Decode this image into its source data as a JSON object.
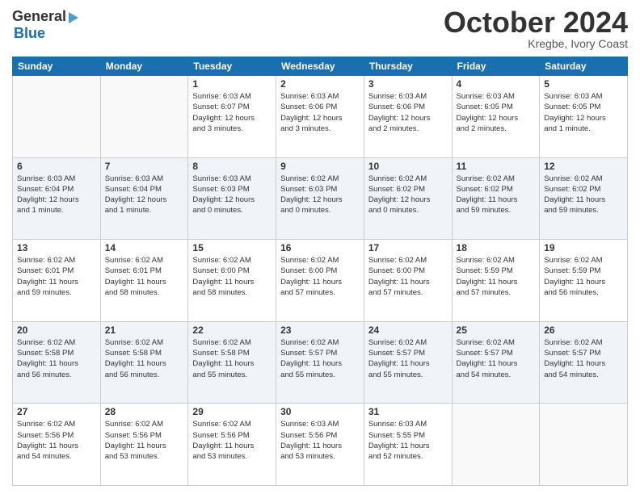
{
  "logo": {
    "top": "General",
    "arrow": "▶",
    "bottom": "Blue"
  },
  "title": "October 2024",
  "subtitle": "Kregbe, Ivory Coast",
  "days_of_week": [
    "Sunday",
    "Monday",
    "Tuesday",
    "Wednesday",
    "Thursday",
    "Friday",
    "Saturday"
  ],
  "weeks": [
    [
      {
        "num": "",
        "info": ""
      },
      {
        "num": "",
        "info": ""
      },
      {
        "num": "1",
        "info": "Sunrise: 6:03 AM\nSunset: 6:07 PM\nDaylight: 12 hours\nand 3 minutes."
      },
      {
        "num": "2",
        "info": "Sunrise: 6:03 AM\nSunset: 6:06 PM\nDaylight: 12 hours\nand 3 minutes."
      },
      {
        "num": "3",
        "info": "Sunrise: 6:03 AM\nSunset: 6:06 PM\nDaylight: 12 hours\nand 2 minutes."
      },
      {
        "num": "4",
        "info": "Sunrise: 6:03 AM\nSunset: 6:05 PM\nDaylight: 12 hours\nand 2 minutes."
      },
      {
        "num": "5",
        "info": "Sunrise: 6:03 AM\nSunset: 6:05 PM\nDaylight: 12 hours\nand 1 minute."
      }
    ],
    [
      {
        "num": "6",
        "info": "Sunrise: 6:03 AM\nSunset: 6:04 PM\nDaylight: 12 hours\nand 1 minute."
      },
      {
        "num": "7",
        "info": "Sunrise: 6:03 AM\nSunset: 6:04 PM\nDaylight: 12 hours\nand 1 minute."
      },
      {
        "num": "8",
        "info": "Sunrise: 6:03 AM\nSunset: 6:03 PM\nDaylight: 12 hours\nand 0 minutes."
      },
      {
        "num": "9",
        "info": "Sunrise: 6:02 AM\nSunset: 6:03 PM\nDaylight: 12 hours\nand 0 minutes."
      },
      {
        "num": "10",
        "info": "Sunrise: 6:02 AM\nSunset: 6:02 PM\nDaylight: 12 hours\nand 0 minutes."
      },
      {
        "num": "11",
        "info": "Sunrise: 6:02 AM\nSunset: 6:02 PM\nDaylight: 11 hours\nand 59 minutes."
      },
      {
        "num": "12",
        "info": "Sunrise: 6:02 AM\nSunset: 6:02 PM\nDaylight: 11 hours\nand 59 minutes."
      }
    ],
    [
      {
        "num": "13",
        "info": "Sunrise: 6:02 AM\nSunset: 6:01 PM\nDaylight: 11 hours\nand 59 minutes."
      },
      {
        "num": "14",
        "info": "Sunrise: 6:02 AM\nSunset: 6:01 PM\nDaylight: 11 hours\nand 58 minutes."
      },
      {
        "num": "15",
        "info": "Sunrise: 6:02 AM\nSunset: 6:00 PM\nDaylight: 11 hours\nand 58 minutes."
      },
      {
        "num": "16",
        "info": "Sunrise: 6:02 AM\nSunset: 6:00 PM\nDaylight: 11 hours\nand 57 minutes."
      },
      {
        "num": "17",
        "info": "Sunrise: 6:02 AM\nSunset: 6:00 PM\nDaylight: 11 hours\nand 57 minutes."
      },
      {
        "num": "18",
        "info": "Sunrise: 6:02 AM\nSunset: 5:59 PM\nDaylight: 11 hours\nand 57 minutes."
      },
      {
        "num": "19",
        "info": "Sunrise: 6:02 AM\nSunset: 5:59 PM\nDaylight: 11 hours\nand 56 minutes."
      }
    ],
    [
      {
        "num": "20",
        "info": "Sunrise: 6:02 AM\nSunset: 5:58 PM\nDaylight: 11 hours\nand 56 minutes."
      },
      {
        "num": "21",
        "info": "Sunrise: 6:02 AM\nSunset: 5:58 PM\nDaylight: 11 hours\nand 56 minutes."
      },
      {
        "num": "22",
        "info": "Sunrise: 6:02 AM\nSunset: 5:58 PM\nDaylight: 11 hours\nand 55 minutes."
      },
      {
        "num": "23",
        "info": "Sunrise: 6:02 AM\nSunset: 5:57 PM\nDaylight: 11 hours\nand 55 minutes."
      },
      {
        "num": "24",
        "info": "Sunrise: 6:02 AM\nSunset: 5:57 PM\nDaylight: 11 hours\nand 55 minutes."
      },
      {
        "num": "25",
        "info": "Sunrise: 6:02 AM\nSunset: 5:57 PM\nDaylight: 11 hours\nand 54 minutes."
      },
      {
        "num": "26",
        "info": "Sunrise: 6:02 AM\nSunset: 5:57 PM\nDaylight: 11 hours\nand 54 minutes."
      }
    ],
    [
      {
        "num": "27",
        "info": "Sunrise: 6:02 AM\nSunset: 5:56 PM\nDaylight: 11 hours\nand 54 minutes."
      },
      {
        "num": "28",
        "info": "Sunrise: 6:02 AM\nSunset: 5:56 PM\nDaylight: 11 hours\nand 53 minutes."
      },
      {
        "num": "29",
        "info": "Sunrise: 6:02 AM\nSunset: 5:56 PM\nDaylight: 11 hours\nand 53 minutes."
      },
      {
        "num": "30",
        "info": "Sunrise: 6:03 AM\nSunset: 5:56 PM\nDaylight: 11 hours\nand 53 minutes."
      },
      {
        "num": "31",
        "info": "Sunrise: 6:03 AM\nSunset: 5:55 PM\nDaylight: 11 hours\nand 52 minutes."
      },
      {
        "num": "",
        "info": ""
      },
      {
        "num": "",
        "info": ""
      }
    ]
  ]
}
